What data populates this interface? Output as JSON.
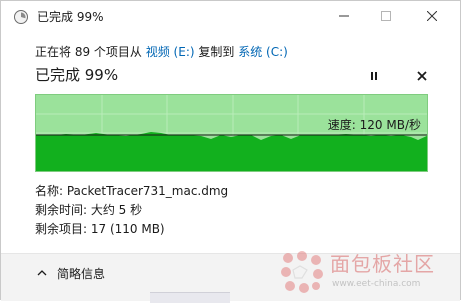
{
  "titlebar": {
    "title": "已完成 99%",
    "icon": "copy-progress-icon"
  },
  "status_line": {
    "prefix": "正在将 89 个项目从",
    "source": "视频 (E:)",
    "middle": "复制到",
    "destination": "系统 (C:)"
  },
  "heading": "已完成 99%",
  "graph": {
    "speed_label": "速度: 120 MB/秒",
    "progress": 0.99
  },
  "details": {
    "name": "名称: PacketTracer731_mac.dmg",
    "time_left": "剩余时间: 大约 5 秒",
    "items_left": "剩余项目: 17 (110 MB)"
  },
  "footer": {
    "fewer_details": "简略信息"
  },
  "watermark": {
    "text": "面包板社区",
    "url": "www.eet-china.com"
  },
  "colors": {
    "graph_fill": "#12b01e",
    "graph_background": "#9be29b",
    "link": "#0066b4"
  }
}
